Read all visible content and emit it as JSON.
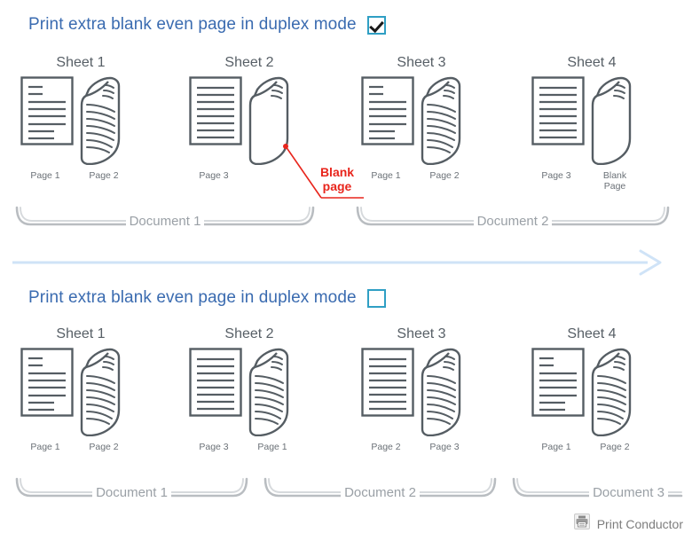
{
  "sections": [
    {
      "id": "duplex-on",
      "option_label": "Print extra blank even page in duplex mode",
      "checkbox_state": "checked",
      "sheets": [
        {
          "title": "Sheet 1",
          "front": {
            "label": "Page 1",
            "style": "mixed"
          },
          "back": {
            "label": "Page 2",
            "style": "lines"
          }
        },
        {
          "title": "Sheet 2",
          "front": {
            "label": "Page 3",
            "style": "full"
          },
          "back": {
            "label": "Blank page",
            "style": "blank"
          }
        },
        {
          "title": "Sheet 3",
          "front": {
            "label": "Page 1",
            "style": "mixed"
          },
          "back": {
            "label": "Page 2",
            "style": "lines"
          }
        },
        {
          "title": "Sheet 4",
          "front": {
            "label": "Page 3",
            "style": "full"
          },
          "back": {
            "label": "Blank\nPage",
            "style": "blank"
          }
        }
      ],
      "brackets": [
        {
          "label": "Document 1"
        },
        {
          "label": "Document 2"
        }
      ]
    },
    {
      "id": "duplex-off",
      "option_label": "Print extra blank even page in duplex mode",
      "checkbox_state": "unchecked",
      "sheets": [
        {
          "title": "Sheet 1",
          "front": {
            "label": "Page 1",
            "style": "mixed"
          },
          "back": {
            "label": "Page 2",
            "style": "lines"
          }
        },
        {
          "title": "Sheet 2",
          "front": {
            "label": "Page 3",
            "style": "full"
          },
          "back": {
            "label": "Page 1",
            "style": "lines"
          }
        },
        {
          "title": "Sheet 3",
          "front": {
            "label": "Page 2",
            "style": "full"
          },
          "back": {
            "label": "Page 3",
            "style": "lines"
          }
        },
        {
          "title": "Sheet 4",
          "front": {
            "label": "Page 1",
            "style": "mixed"
          },
          "back": {
            "label": "Page 2",
            "style": "lines"
          }
        }
      ],
      "brackets": [
        {
          "label": "Document 1"
        },
        {
          "label": "Document 2"
        },
        {
          "label": "Document 3"
        }
      ]
    }
  ],
  "callout": {
    "line1": "Blank",
    "line2": "page",
    "color": "#e8251c"
  },
  "divider": {
    "type": "arrow-right",
    "color": "#cfe3f7"
  },
  "footer": {
    "brand": "Print Conductor",
    "icon": "printer-icon"
  },
  "colors": {
    "heading_blue": "#3a6bb0",
    "checkbox_border": "#2f9fc4",
    "page_outline": "#555d63",
    "bracket_gray": "#b9bdc1",
    "label_gray": "#6b7177"
  }
}
